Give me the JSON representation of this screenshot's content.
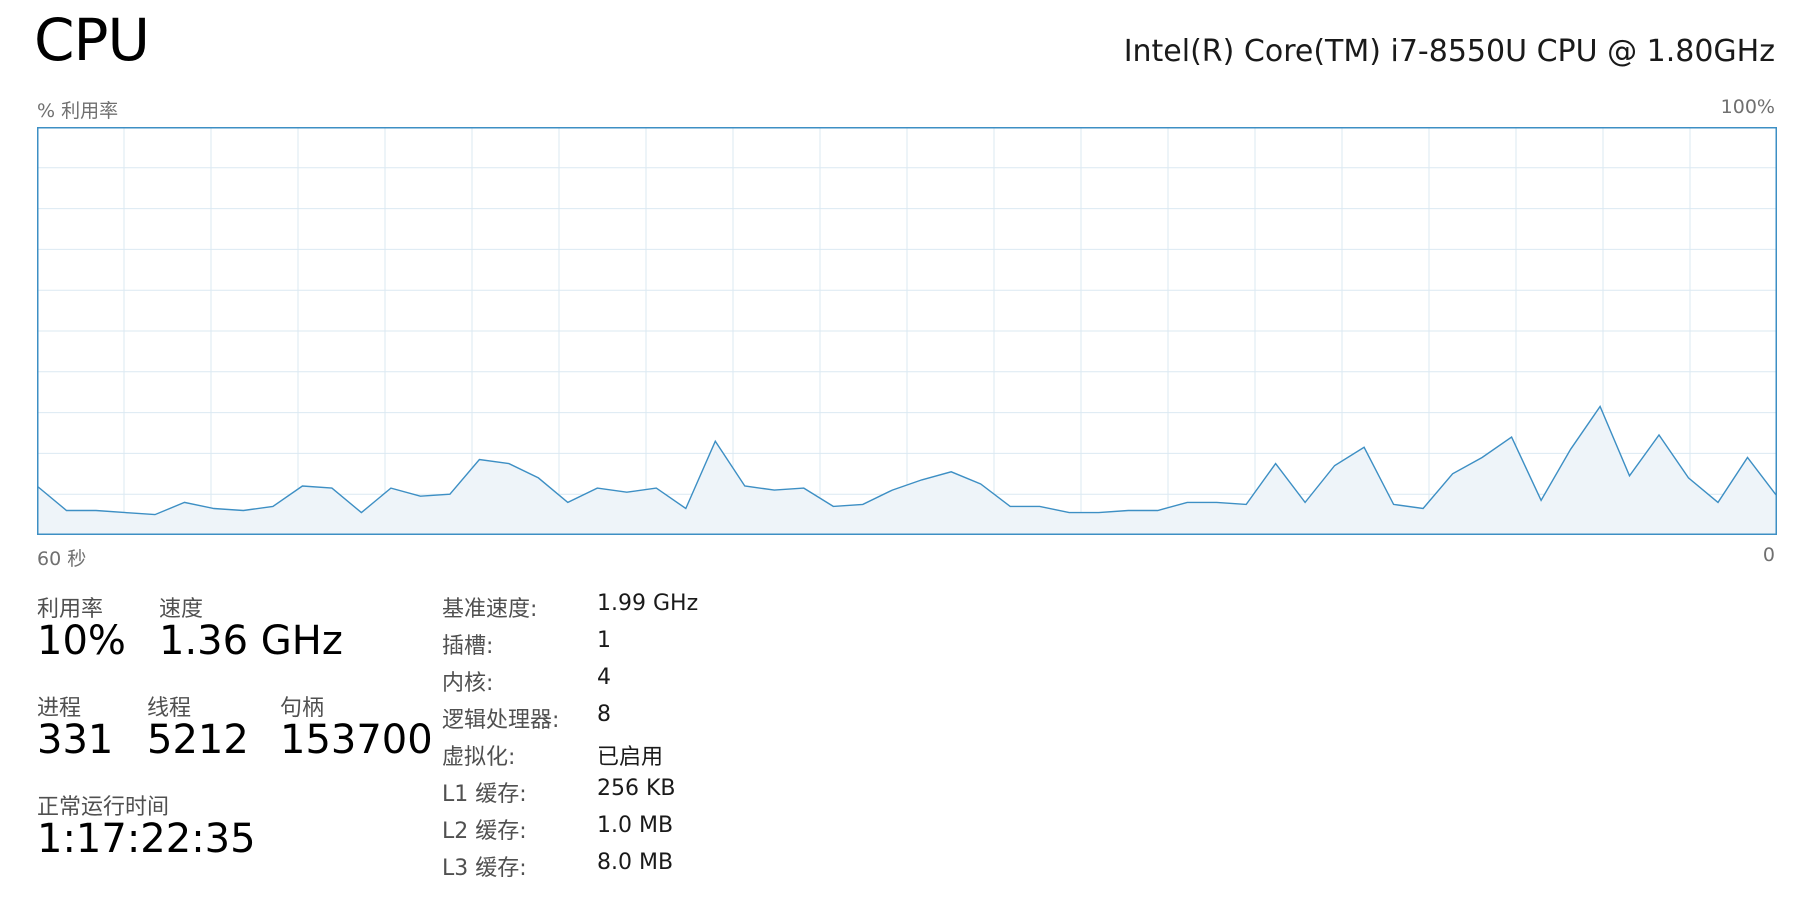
{
  "header": {
    "title": "CPU",
    "cpu_model": "Intel(R) Core(TM) i7-8550U CPU @ 1.80GHz"
  },
  "graph": {
    "y_label": "% 利用率",
    "y_max": "100%",
    "x_left": "60 秒",
    "x_right": "0",
    "line_color": "#3d8fc4",
    "fill_color": "#eef4f9",
    "grid_color": "#dbe9f2",
    "border_color": "#3d8fc4",
    "utilization_history": [
      12,
      6,
      6,
      5.5,
      5,
      8,
      6.5,
      6,
      7,
      12,
      11.5,
      5.5,
      11.5,
      9.5,
      10,
      18.5,
      17.5,
      14,
      8,
      11.5,
      10.5,
      11.5,
      6.5,
      23,
      12,
      11,
      11.5,
      7,
      7.5,
      11,
      13.5,
      15.5,
      12.5,
      7,
      7,
      5.5,
      5.5,
      6,
      6,
      8,
      8,
      7.5,
      17.5,
      8,
      17,
      21.5,
      7.5,
      6.5,
      15,
      19,
      24,
      8.5,
      21,
      31.5,
      14.5,
      24.5,
      14,
      8,
      19,
      9.5
    ]
  },
  "stats": {
    "utilization": {
      "label": "利用率",
      "value": "10%"
    },
    "speed": {
      "label": "速度",
      "value": "1.36 GHz"
    },
    "processes": {
      "label": "进程",
      "value": "331"
    },
    "threads": {
      "label": "线程",
      "value": "5212"
    },
    "handles": {
      "label": "句柄",
      "value": "153700"
    },
    "uptime": {
      "label": "正常运行时间",
      "value": "1:17:22:35"
    }
  },
  "specs": [
    {
      "label": "基准速度:",
      "value": "1.99 GHz"
    },
    {
      "label": "插槽:",
      "value": "1"
    },
    {
      "label": "内核:",
      "value": "4"
    },
    {
      "label": "逻辑处理器:",
      "value": "8"
    },
    {
      "label": "虚拟化:",
      "value": "已启用"
    },
    {
      "label": "L1 缓存:",
      "value": "256 KB"
    },
    {
      "label": "L2 缓存:",
      "value": "1.0 MB"
    },
    {
      "label": "L3 缓存:",
      "value": "8.0 MB"
    }
  ]
}
